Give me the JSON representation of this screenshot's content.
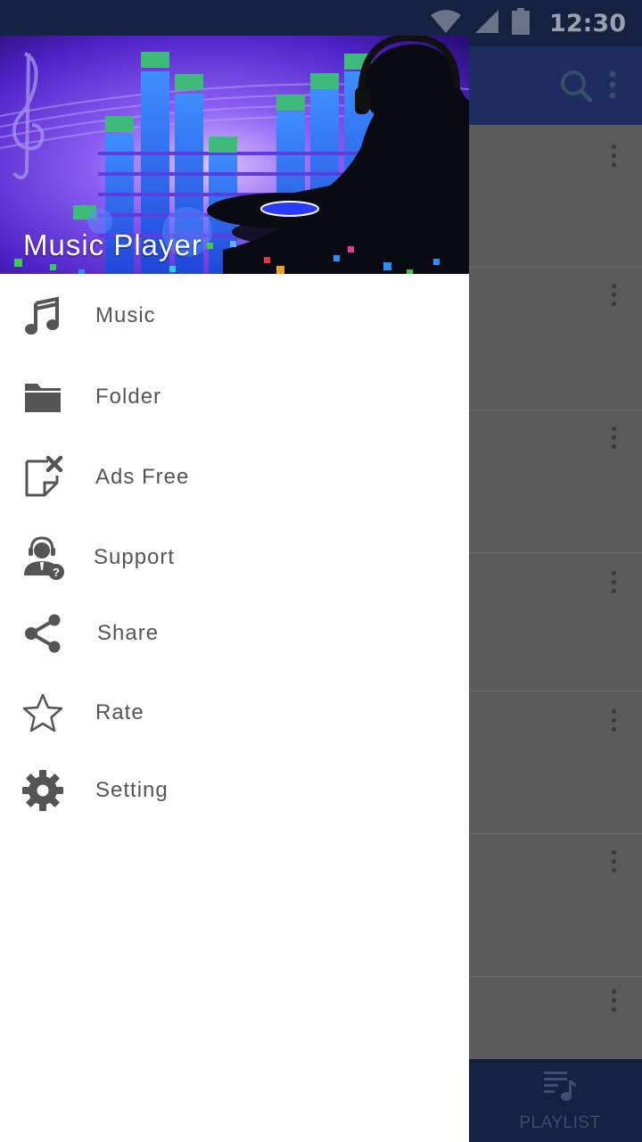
{
  "status_bar": {
    "time": "12:30"
  },
  "drawer": {
    "title": "Music Player",
    "items": [
      {
        "label": "Music",
        "icon": "music-note-icon"
      },
      {
        "label": "Folder",
        "icon": "folder-icon"
      },
      {
        "label": "Ads Free",
        "icon": "ads-free-icon"
      },
      {
        "label": "Support",
        "icon": "support-agent-icon"
      },
      {
        "label": "Share",
        "icon": "share-icon"
      },
      {
        "label": "Rate",
        "icon": "star-icon"
      },
      {
        "label": "Setting",
        "icon": "gear-icon"
      }
    ]
  },
  "background": {
    "toolbar_icons": [
      "search-icon",
      "more-vert-icon"
    ],
    "bottom_tab": {
      "label": "PLAYLIST",
      "icon": "playlist-icon"
    }
  },
  "colors": {
    "status_bar": "#14213f",
    "toolbar": "#1b2e5f",
    "drawer_bg": "#ffffff",
    "menu_text": "#555555",
    "menu_icon": "#555555",
    "scrim": "#5b5b5b"
  }
}
